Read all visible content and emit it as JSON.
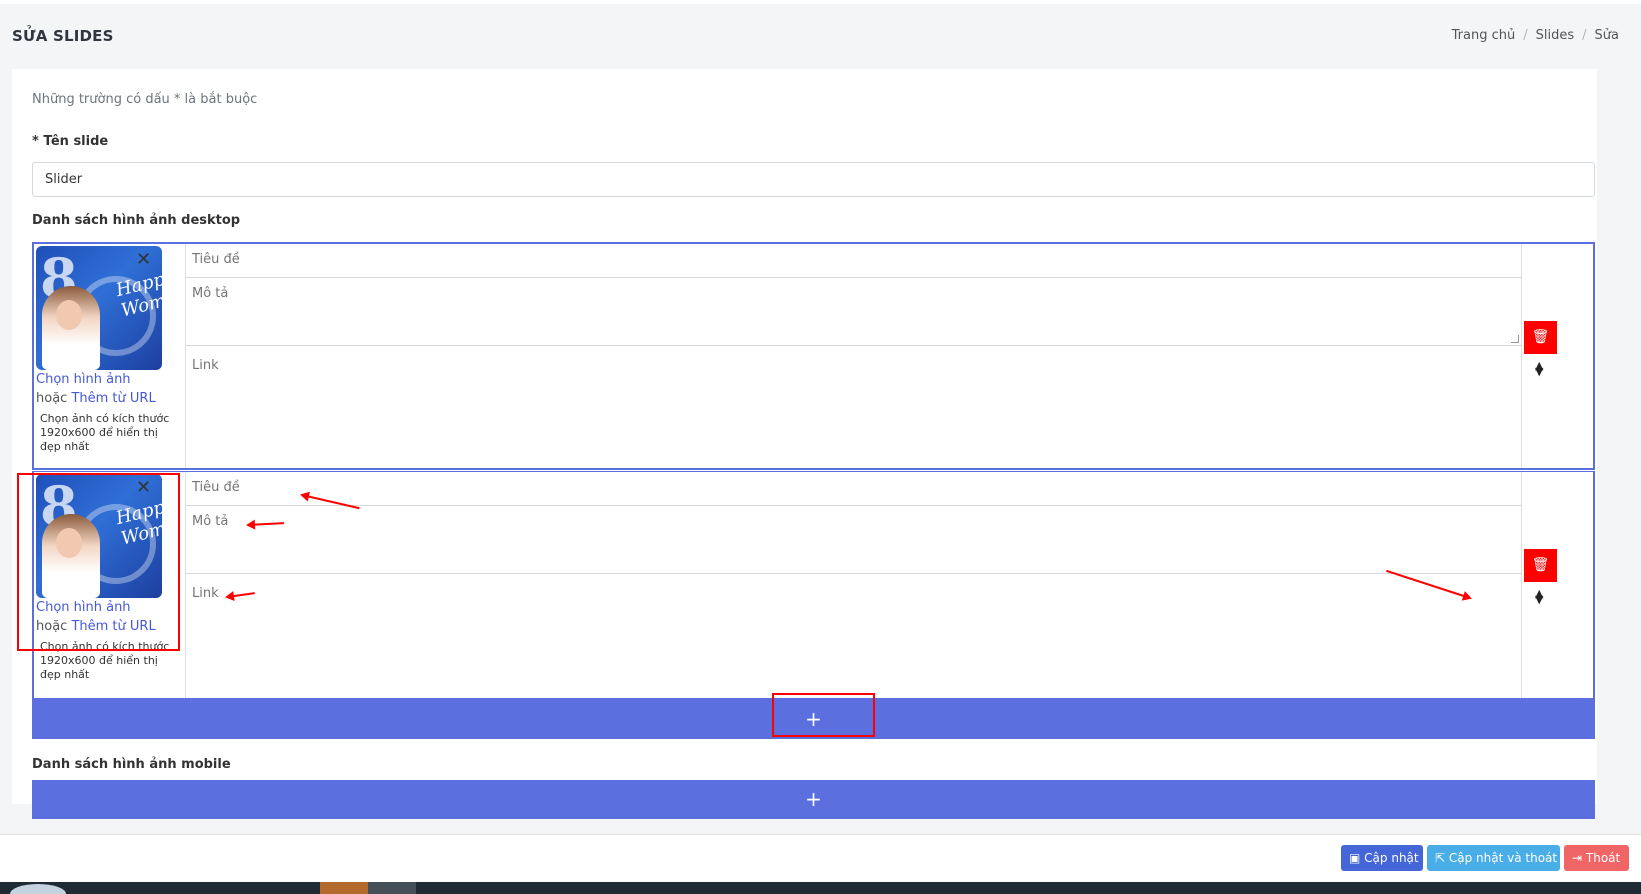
{
  "page": {
    "title": "SỬA SLIDES"
  },
  "breadcrumb": [
    "Trang chủ",
    "Slides",
    "Sửa"
  ],
  "form": {
    "required_hint": "Những trường có dấu * là bắt buộc",
    "name_label": "* Tên slide",
    "name_value": "Slider",
    "desktop_label": "Danh sách hình ảnh desktop",
    "mobile_label": "Danh sách hình ảnh mobile"
  },
  "slides": [
    {
      "choose_image": "Chọn hình ảnh",
      "or_text": "hoặc",
      "add_from_url": "Thêm từ URL",
      "size_note": "Chọn ảnh có kích thước 1920x600 để hiển thị đẹp nhất",
      "title_placeholder": "Tiêu đề",
      "desc_placeholder": "Mô tả",
      "link_placeholder": "Link"
    },
    {
      "choose_image": "Chọn hình ảnh",
      "or_text": "hoặc",
      "add_from_url": "Thêm từ URL",
      "size_note": "Chọn ảnh có kích thước 1920x600 để hiển thị đẹp nhất",
      "title_placeholder": "Tiêu đề",
      "desc_placeholder": "Mô tả",
      "link_placeholder": "Link"
    }
  ],
  "add_symbol": "+",
  "actions": {
    "update": "Cập nhật",
    "update_exit": "Cập nhật và thoát",
    "exit": "Thoát"
  },
  "icons": {
    "delete": "trash-icon",
    "sort": "sort-icon",
    "save": "save-icon",
    "share": "share-icon",
    "exit": "sign-out-icon",
    "close": "close-icon"
  },
  "colors": {
    "primary": "#5b6fdf",
    "danger": "#ff0000",
    "info": "#49aee8",
    "exit": "#f06565",
    "annotation": "#ff0000"
  }
}
